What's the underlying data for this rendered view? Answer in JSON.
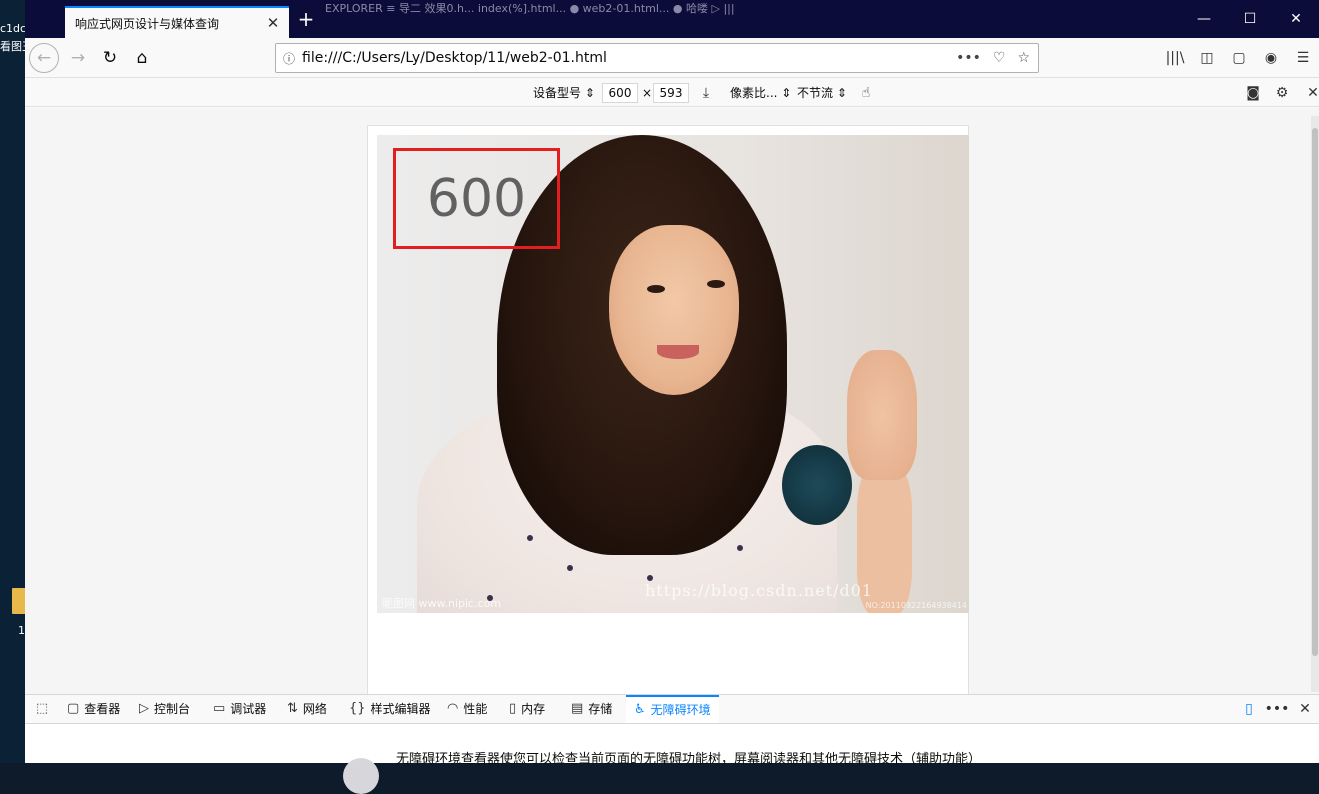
{
  "desktop": {
    "label1": "c1dc",
    "label2": "看图王",
    "number": "1"
  },
  "browser": {
    "active_tab_title": "响应式网页设计与媒体查询",
    "background_tabs": "EXPLORER   ≡ 导二 效果0.h...   index(%].html...   ●  web2-01.html...   ● 哈喽   ▷   |||",
    "url": "file:///C:/Users/Ly/Desktop/11/web2-01.html"
  },
  "rdm": {
    "device_label": "设备型号",
    "width": "600",
    "times": "×",
    "height": "593",
    "pixel_ratio_label": "像素比...",
    "throttle_label": "不节流"
  },
  "page": {
    "size_text": "600",
    "watermark": "https://blog.csdn.net/d01",
    "watermark_site": "昵图网 www.nipic.com",
    "watermark_id": "NO:20110922164938414"
  },
  "devtools": {
    "tabs": [
      {
        "label": "查看器",
        "icon": "inspector-icon"
      },
      {
        "label": "控制台",
        "icon": "console-icon"
      },
      {
        "label": "调试器",
        "icon": "debugger-icon"
      },
      {
        "label": "网络",
        "icon": "network-icon"
      },
      {
        "label": "样式编辑器",
        "icon": "style-editor-icon"
      },
      {
        "label": "性能",
        "icon": "performance-icon"
      },
      {
        "label": "内存",
        "icon": "memory-icon"
      },
      {
        "label": "存储",
        "icon": "storage-icon"
      },
      {
        "label": "无障碍环境",
        "icon": "accessibility-icon"
      }
    ],
    "active_tab": "无障碍环境",
    "a11y_message": "无障碍环境查看器使您可以检查当前页面的无障碍功能树，屏幕阅读器和其他无障碍技术（辅助功能）"
  },
  "colors": {
    "accent": "#0a84ff",
    "title_bar": "#0c0c3a",
    "size_box_border": "#e21e1e"
  }
}
